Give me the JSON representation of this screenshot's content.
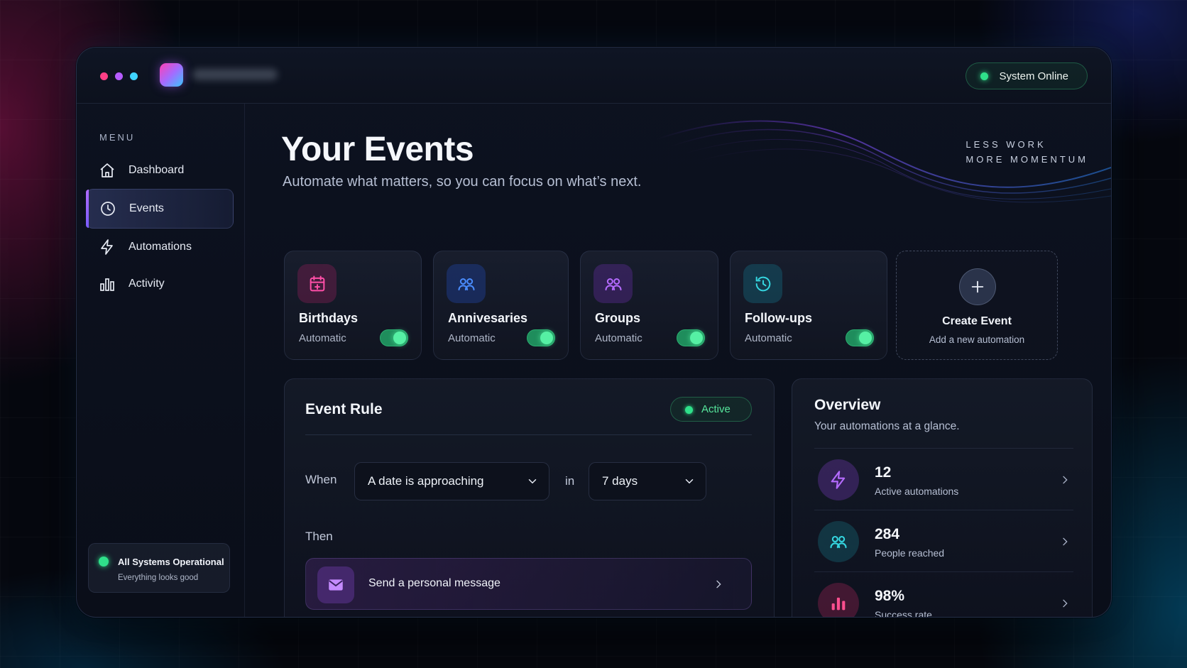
{
  "titlebar": {
    "window_dots": [
      "#ff3f86",
      "#b65cff",
      "#3fd4ff"
    ],
    "status": "System Online"
  },
  "sidebar": {
    "menu_label": "MENU",
    "items": [
      {
        "label": "Dashboard",
        "icon": "home-icon",
        "active": false
      },
      {
        "label": "Events",
        "icon": "clock-icon",
        "active": true
      },
      {
        "label": "Automations",
        "icon": "lightning-icon",
        "active": false
      },
      {
        "label": "Activity",
        "icon": "bar-chart-icon",
        "active": false
      }
    ],
    "system_status": {
      "title": "All Systems Operational",
      "subtitle": "Everything looks good"
    }
  },
  "header": {
    "title": "Your Events",
    "subtitle": "Automate what matters, so you can focus on what’s next.",
    "tagline_line1": "LESS WORK",
    "tagline_line2": "MORE MOMENTUM"
  },
  "event_cards": [
    {
      "title": "Birthdays",
      "subtitle": "Automatic",
      "icon": "calendar-icon",
      "accent": "#ff4fa8",
      "enabled": true
    },
    {
      "title": "Annivesaries",
      "subtitle": "Automatic",
      "icon": "people-icon",
      "accent": "#4a8dff",
      "enabled": true
    },
    {
      "title": "Groups",
      "subtitle": "Automatic",
      "icon": "group-icon",
      "accent": "#b56bff",
      "enabled": true
    },
    {
      "title": "Follow-ups",
      "subtitle": "Automatic",
      "icon": "history-icon",
      "accent": "#35d6e0",
      "enabled": true
    }
  ],
  "create_card": {
    "title": "Create Event",
    "subtitle": "Add a new automation"
  },
  "event_rule": {
    "title": "Event Rule",
    "status": "Active",
    "when_label": "When",
    "condition": "A date is approaching",
    "in_label": "in",
    "offset": "7 days",
    "then_label": "Then",
    "action": "Send a personal message"
  },
  "overview": {
    "title": "Overview",
    "subtitle": "Your automations at a glance.",
    "stats": [
      {
        "value": "12",
        "label": "Active automations",
        "icon": "lightning-icon",
        "accent": "#b56bff"
      },
      {
        "value": "284",
        "label": "People reached",
        "icon": "people-icon",
        "accent": "#35d6e0"
      },
      {
        "value": "98%",
        "label": "Success rate",
        "icon": "bar-chart-icon",
        "accent": "#ff4f8f"
      }
    ]
  }
}
